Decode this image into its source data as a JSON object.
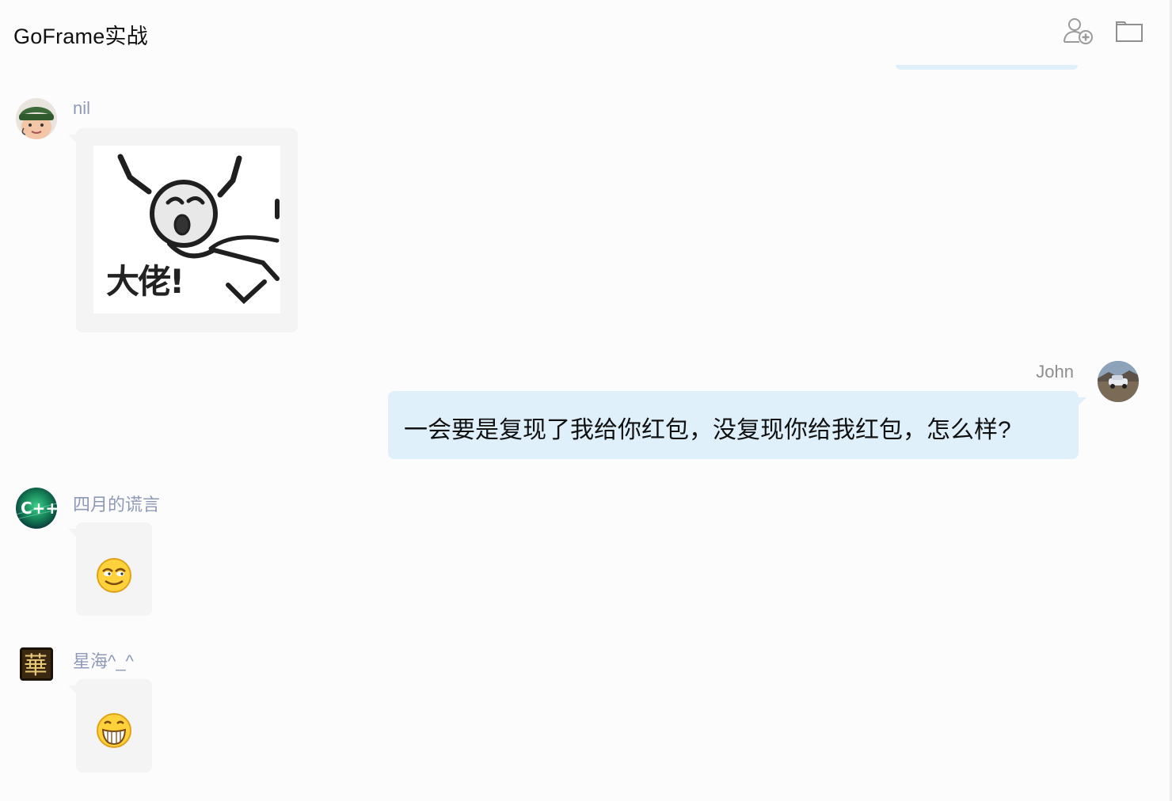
{
  "app": {
    "title": "GoFrame实战"
  },
  "header_icons": {
    "add_member": "add-member-icon",
    "folder": "folder-icon"
  },
  "colors": {
    "background": "#fcfcfc",
    "sender_name": "#8e9ab5",
    "incoming_bubble": "#f4f4f4",
    "outgoing_bubble": "#dff0fb",
    "text": "#111111"
  },
  "messages": [
    {
      "sender": "nil",
      "direction": "incoming",
      "type": "sticker",
      "sticker_caption": "大佬!"
    },
    {
      "sender": "John",
      "direction": "outgoing",
      "type": "text",
      "text": "一会要是复现了我给你红包，没复现你给我红包，怎么样?"
    },
    {
      "sender": "四月的谎言",
      "direction": "incoming",
      "type": "emoji",
      "emoji": "smirk-emoji"
    },
    {
      "sender": "星海^_^",
      "direction": "incoming",
      "type": "emoji",
      "emoji": "grin-emoji"
    }
  ]
}
